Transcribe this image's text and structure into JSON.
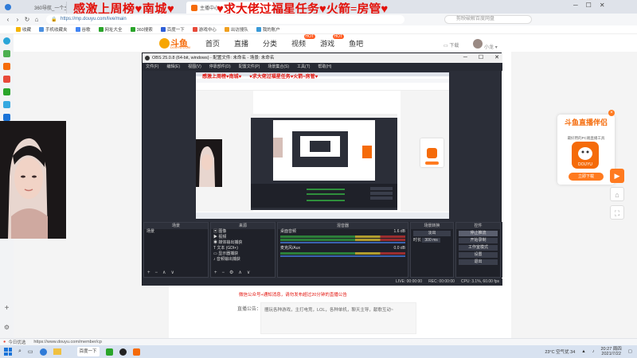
{
  "browser": {
    "tabs": [
      {
        "label": "360导航_一个主页，",
        "active": false
      },
      {
        "label": "主播中心",
        "active": true
      }
    ],
    "url": "https://mp.douyu.com/live/main",
    "search_placeholder": "剪映破解百度网盘"
  },
  "banner": {
    "left": "感激上周榜♥南城♥",
    "right": "♥求大佬过福星任务♥火箭=房管♥"
  },
  "bookmarks": [
    "收藏",
    "手机收藏夹",
    "谷歌",
    "网址大全",
    "360搜索",
    "百度一下",
    "游戏中心",
    "出访搜队",
    "我的账户"
  ],
  "douyu": {
    "logo_text": "斗鱼",
    "logo_sub": "DOUYU.COM",
    "nav": [
      "首页",
      "直播",
      "分类",
      "视频",
      "游戏",
      "鱼吧"
    ],
    "hot_badge": "HOT",
    "download": "下载",
    "username": "小龙",
    "notice_red": "微信公众号+通知消息，请勿发布超过20分钟的直播公告",
    "notice_label": "直播公告：",
    "notice_text": "擅玩各种游戏，主打电竞，LOL，各种单机，聊天主导，献歌互动~"
  },
  "promo": {
    "title": "斗鱼直播伴侣",
    "subtitle": "最好用的PC端直播工具",
    "button": "立即下载",
    "app_name": "DOUYU"
  },
  "obs": {
    "title": "OBS 25.0.8 (64-bit, windows) - 配置文件: 未命名 - 场景: 未命名",
    "menu": [
      "文件(F)",
      "编辑(E)",
      "视图(V)",
      "停靠部件(D)",
      "配置文件(P)",
      "场景集合(S)",
      "工具(T)",
      "帮助(H)"
    ],
    "docks": {
      "scenes": {
        "title": "场景",
        "items": [
          "场景"
        ]
      },
      "sources": {
        "title": "来源",
        "items": [
          "图像",
          "视频",
          "媒体输出捕获",
          "文本 (GDI+)",
          "显示器捕获",
          "音频输出捕获"
        ]
      },
      "mixer": {
        "title": "混音器",
        "channels": [
          {
            "name": "桌面音频",
            "level": "1.6 dB"
          },
          {
            "name": "麦克风/Aux",
            "level": "0.0 dB"
          }
        ]
      },
      "transitions": {
        "title": "场景转换",
        "type": "淡出",
        "duration_label": "时长",
        "duration": "300 ms"
      },
      "controls": {
        "title": "控件",
        "buttons": [
          "停止推流",
          "开始录制",
          "工作室模式",
          "设置",
          "退出"
        ]
      }
    },
    "status": [
      "LIVE: 00:00:00",
      "REC: 00:00:00",
      "CPU: 3.1%, 60.00 fps"
    ]
  },
  "taskbar": {
    "tips": "今日优选",
    "tip_url": "https://www.douyu.com/member/cp",
    "search": "在这里输入你要搜索的内容",
    "apps": [
      "百度一下",
      "OBS"
    ],
    "weather": "23°C 空气优 34",
    "time": "20:27",
    "date": "2021/7/22",
    "day": "周四"
  },
  "colors": {
    "accent": "#f56b0a",
    "banner_red": "#e3120b",
    "obs_dark": "#2b2e38",
    "taskbar": "#d8e2f0"
  }
}
